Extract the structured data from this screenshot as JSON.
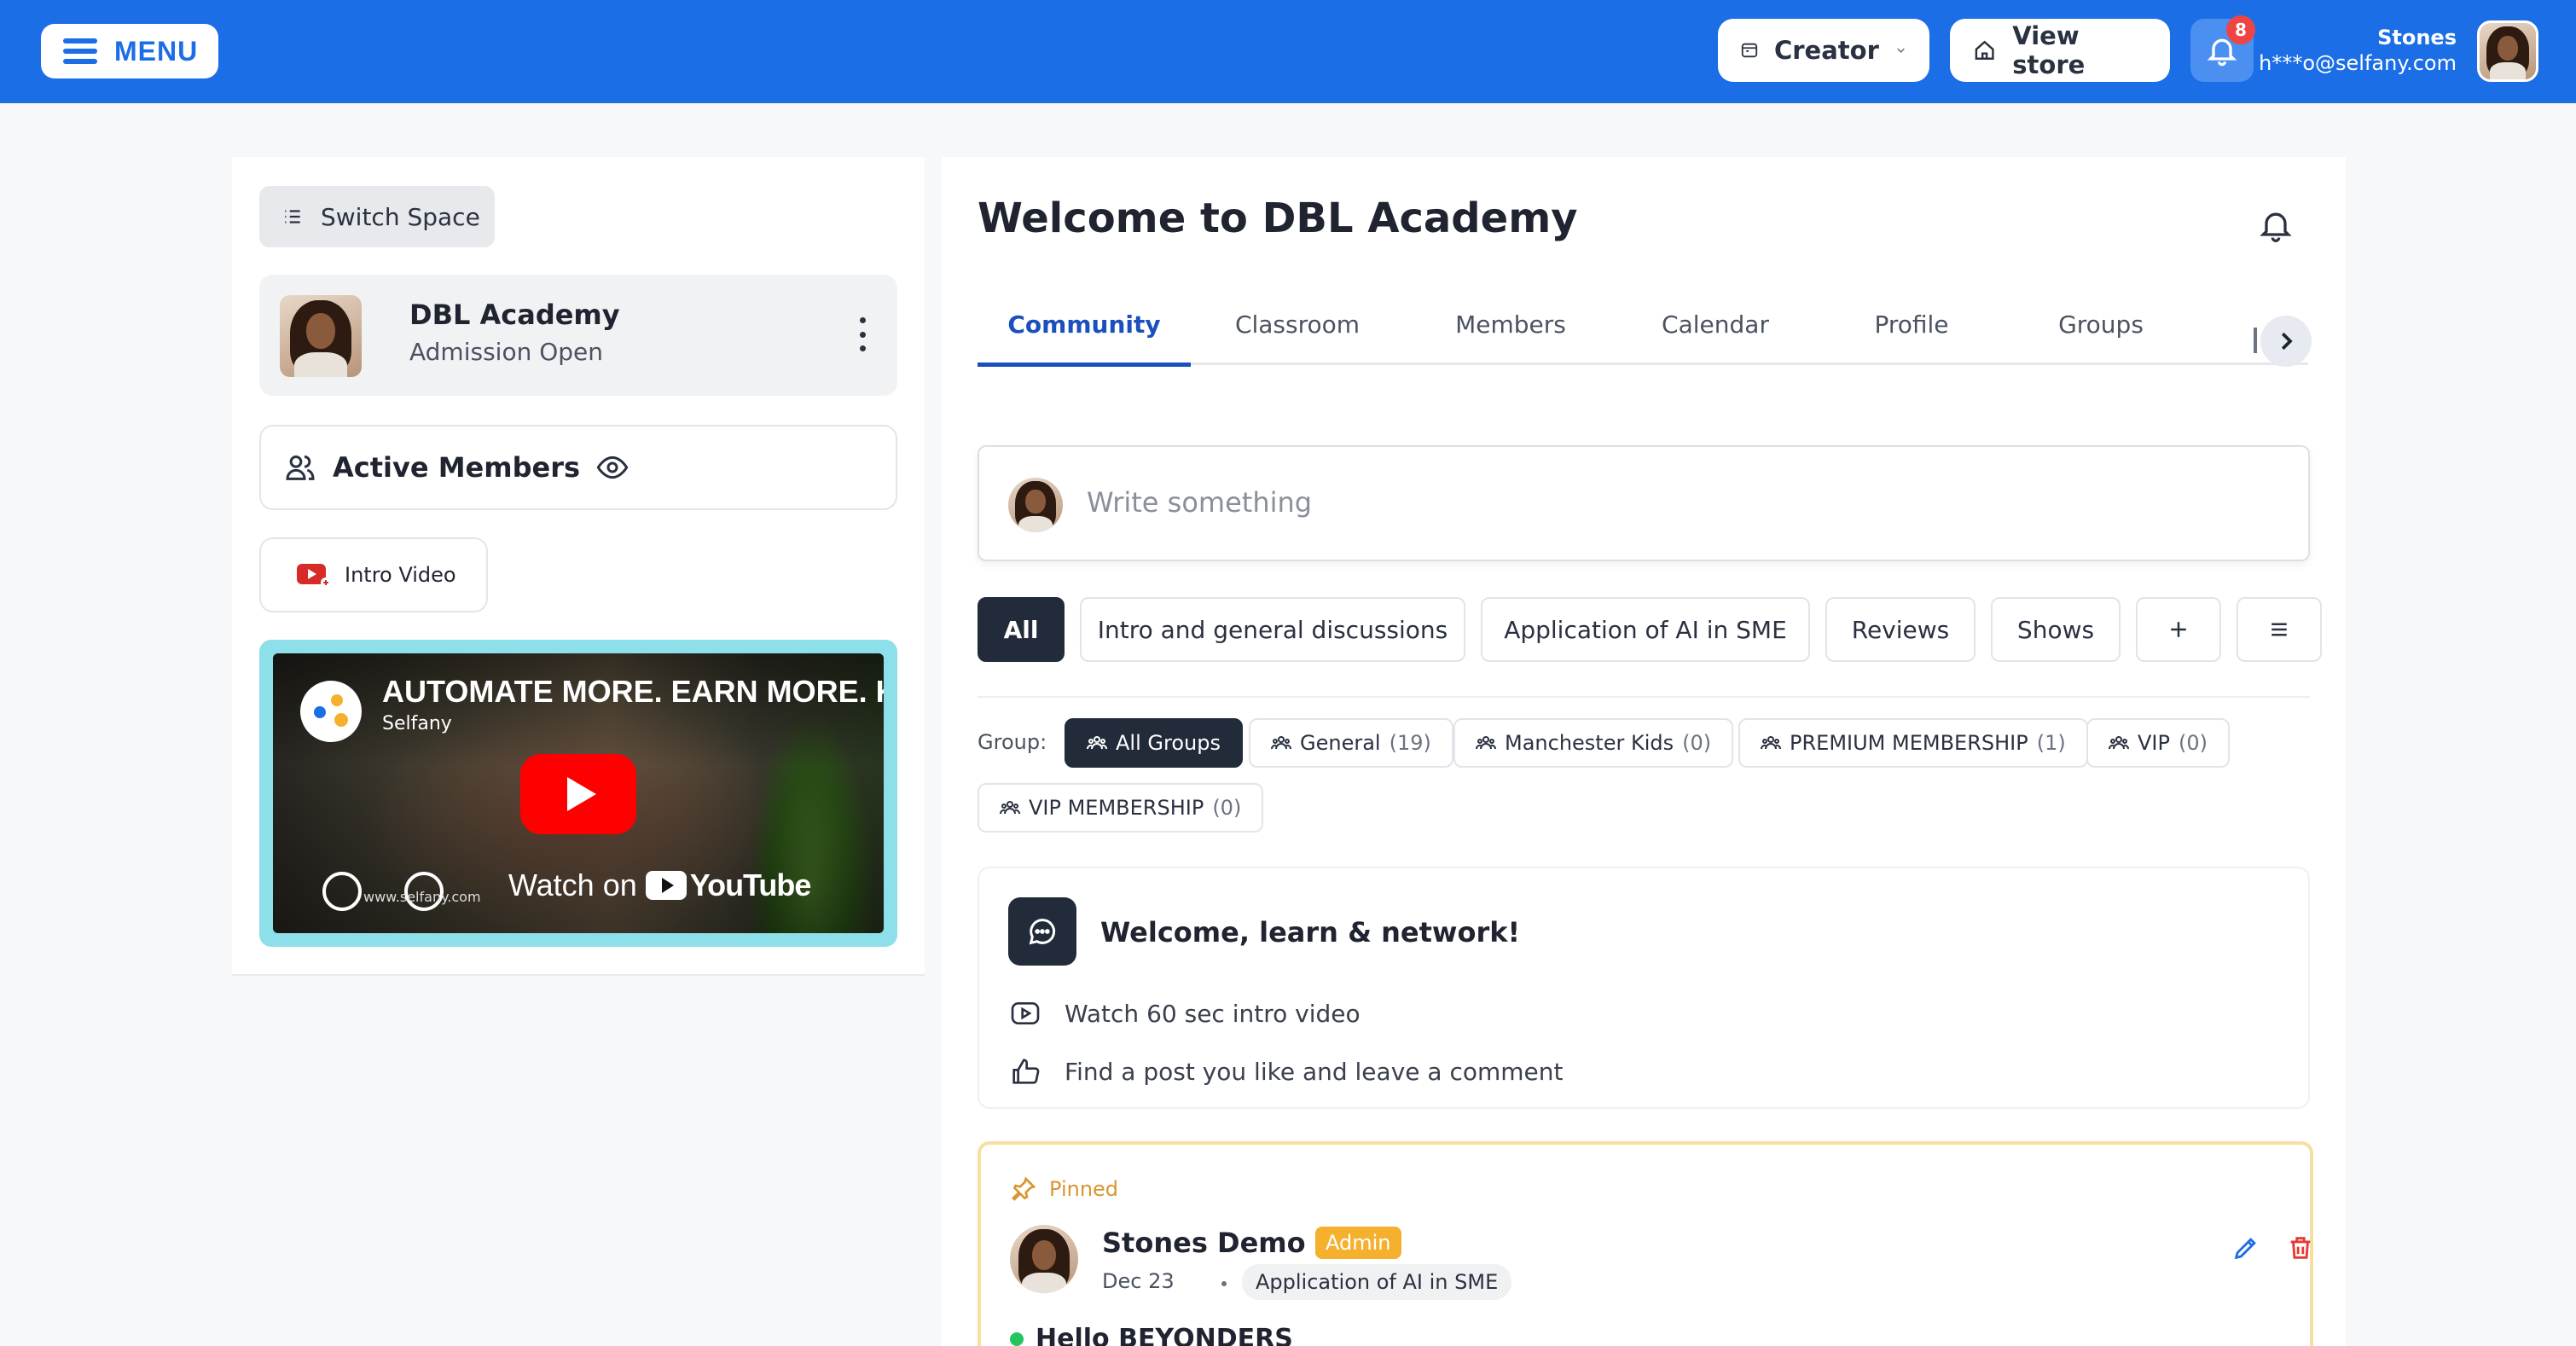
{
  "topbar": {
    "menu_label": "MENU",
    "creator_label": "Creator",
    "view_store_label": "View store",
    "notification_count": "8",
    "user_name": "Stones",
    "user_email": "h***o@selfany.com",
    "brand_color": "#1b6ee6"
  },
  "sidebar": {
    "switch_space_label": "Switch Space",
    "space_name": "DBL Academy",
    "space_status": "Admission Open",
    "active_members_label": "Active Members",
    "intro_video_label": "Intro Video",
    "video": {
      "title": "AUTOMATE MORE. EARN MORE. K",
      "channel": "Selfany",
      "watch_on": "Watch on",
      "platform": "YouTube",
      "url_overlay": "www.selfany.com"
    }
  },
  "main": {
    "title": "Welcome to DBL Academy",
    "tabs": [
      {
        "label": "Community",
        "active": true
      },
      {
        "label": "Classroom"
      },
      {
        "label": "Members"
      },
      {
        "label": "Calendar"
      },
      {
        "label": "Profile"
      },
      {
        "label": "Groups"
      }
    ],
    "composer_placeholder": "Write something",
    "filters": [
      {
        "label": "All",
        "active": true
      },
      {
        "label": "Intro and general discussions"
      },
      {
        "label": "Application of AI in SME"
      },
      {
        "label": "Reviews"
      },
      {
        "label": "Shows"
      }
    ],
    "group_label": "Group:",
    "groups": [
      {
        "label": "All Groups",
        "count": "",
        "active": true
      },
      {
        "label": "General",
        "count": "(19)"
      },
      {
        "label": "Manchester Kids",
        "count": "(0)"
      },
      {
        "label": "PREMIUM MEMBERSHIP",
        "count": "(1)"
      },
      {
        "label": "VIP",
        "count": "(0)"
      },
      {
        "label": "VIP MEMBERSHIP",
        "count": "(0)"
      }
    ],
    "welcome_card": {
      "title": "Welcome, learn & network!",
      "items": [
        "Watch 60 sec intro video",
        "Find a post you like and leave a comment"
      ]
    },
    "pinned_post": {
      "pinned_label": "Pinned",
      "author": "Stones Demo",
      "role_badge": "Admin",
      "date": "Dec 23",
      "category": "Application of AI in SME",
      "body_start": "Hello BEYONDERS"
    }
  }
}
